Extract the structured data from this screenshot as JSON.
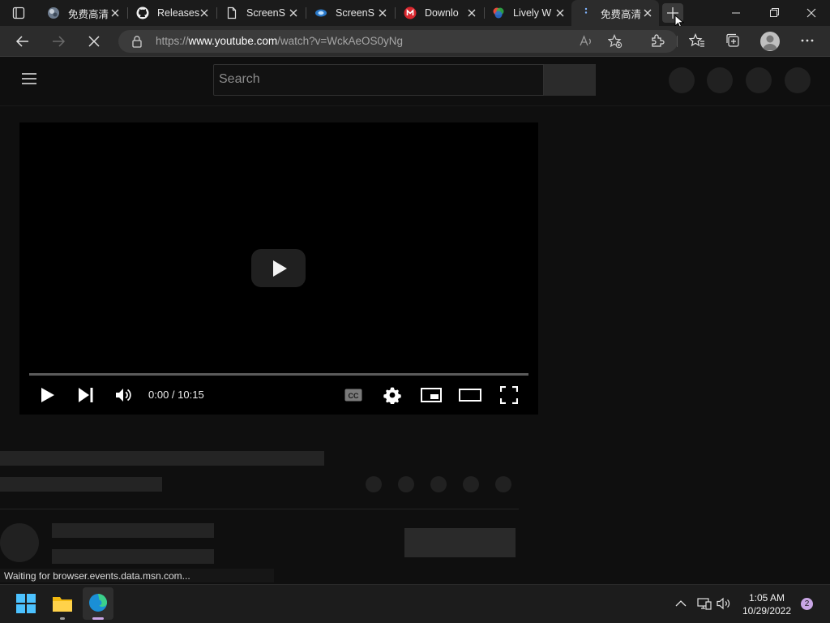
{
  "browser": {
    "tabs": [
      {
        "title": "免费高清",
        "icon": "globe-icon",
        "active": false
      },
      {
        "title": "Releases",
        "icon": "github-icon",
        "active": false
      },
      {
        "title": "ScreenS",
        "icon": "document-icon",
        "active": false
      },
      {
        "title": "ScreenS",
        "icon": "screenshot-app-icon",
        "active": false
      },
      {
        "title": "Downlo",
        "icon": "mega-icon",
        "active": false
      },
      {
        "title": "Lively W",
        "icon": "lively-icon",
        "active": false
      },
      {
        "title": "免费高清",
        "icon": "loading-icon",
        "active": true
      }
    ],
    "address": {
      "scheme": "https://",
      "host": "www.youtube.com",
      "path": "/watch?v=WckAeOS0yNg"
    }
  },
  "youtube": {
    "search_placeholder": "Search",
    "player": {
      "time": "0:00 / 10:15",
      "progress": 0
    }
  },
  "status_bar": "Waiting for browser.events.data.msn.com...",
  "taskbar": {
    "time": "1:05 AM",
    "date": "10/29/2022",
    "notification_count": "2"
  },
  "colors": {
    "page_bg": "#0f0f0f",
    "chrome_bg": "#2c2c2c",
    "edge_accent": "#c9a6e6"
  }
}
